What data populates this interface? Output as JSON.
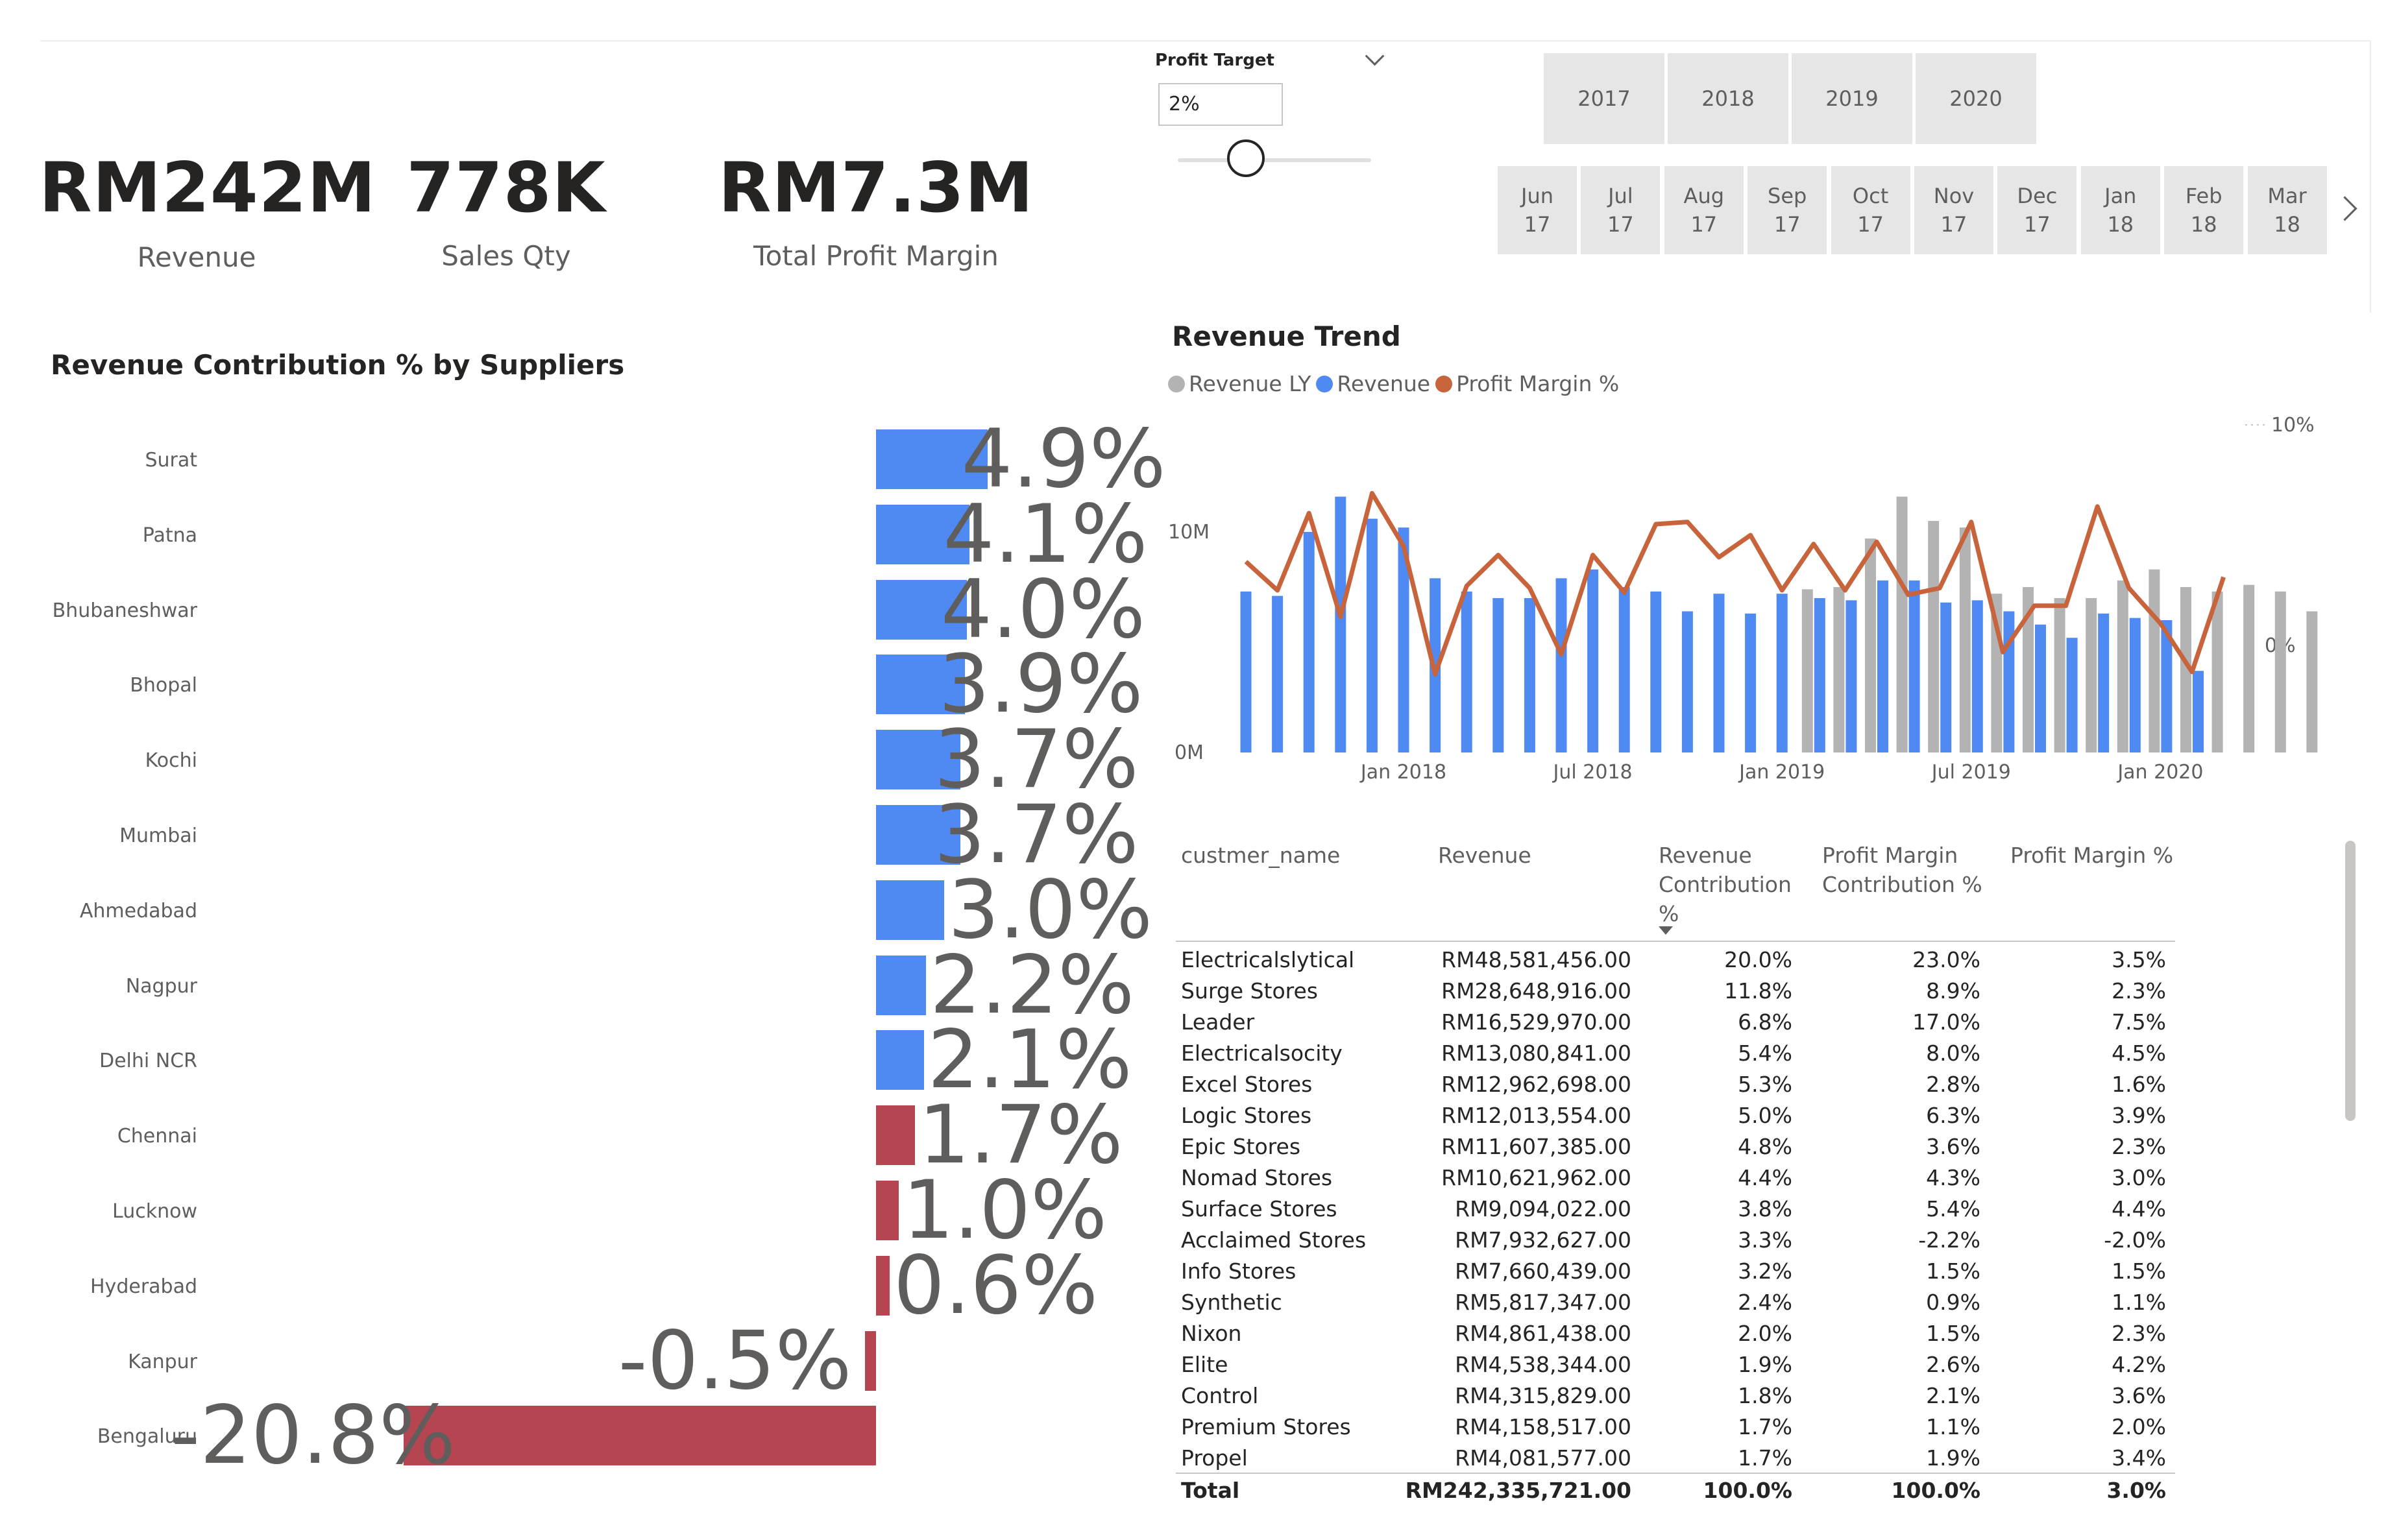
{
  "kpis": [
    {
      "value": "RM242M",
      "label": "Revenue"
    },
    {
      "value": "778K",
      "label": "Sales Qty"
    },
    {
      "value": "RM7.3M",
      "label": "Total Profit Margin"
    }
  ],
  "profit_target": {
    "title": "Profit Target",
    "value": "2%"
  },
  "years": [
    "2017",
    "2018",
    "2019",
    "2020"
  ],
  "months": [
    {
      "m": "Jun",
      "y": "17"
    },
    {
      "m": "Jul",
      "y": "17"
    },
    {
      "m": "Aug",
      "y": "17"
    },
    {
      "m": "Sep",
      "y": "17"
    },
    {
      "m": "Oct",
      "y": "17"
    },
    {
      "m": "Nov",
      "y": "17"
    },
    {
      "m": "Dec",
      "y": "17"
    },
    {
      "m": "Jan",
      "y": "18"
    },
    {
      "m": "Feb",
      "y": "18"
    },
    {
      "m": "Mar",
      "y": "18"
    }
  ],
  "suppliers_title": "Revenue Contribution % by Suppliers",
  "revenue_trend_title": "Revenue Trend",
  "legend": [
    "Revenue LY",
    "Revenue",
    "Profit Margin %"
  ],
  "colors": {
    "positive": "#4e8af2",
    "negative": "#b54550",
    "revenue_ly": "#b3b3b3",
    "revenue": "#4e8af2",
    "profit": "#c8643c"
  },
  "chart_data": [
    {
      "type": "bar",
      "title": "Revenue Contribution % by Suppliers",
      "categories": [
        "Surat",
        "Patna",
        "Bhubaneshwar",
        "Bhopal",
        "Kochi",
        "Mumbai",
        "Ahmedabad",
        "Nagpur",
        "Delhi NCR",
        "Chennai",
        "Lucknow",
        "Hyderabad",
        "Kanpur",
        "Bengaluru"
      ],
      "values": [
        4.9,
        4.1,
        4.0,
        3.9,
        3.7,
        3.7,
        3.0,
        2.2,
        2.1,
        1.7,
        1.0,
        0.6,
        -0.5,
        -20.8
      ],
      "labels": [
        "4.9%",
        "4.1%",
        "4.0%",
        "3.9%",
        "3.7%",
        "3.7%",
        "3.0%",
        "2.2%",
        "2.1%",
        "1.7%",
        "1.0%",
        "0.6%",
        "-0.5%",
        "-20.8%"
      ],
      "orientation": "horizontal"
    },
    {
      "type": "bar",
      "title": "Revenue Trend",
      "x": [
        "2017-08",
        "2017-09",
        "2017-10",
        "2017-11",
        "2017-12",
        "2018-01",
        "2018-02",
        "2018-03",
        "2018-04",
        "2018-05",
        "2018-06",
        "2018-07",
        "2018-08",
        "2018-09",
        "2018-10",
        "2018-11",
        "2018-12",
        "2019-01",
        "2019-02",
        "2019-03",
        "2019-04",
        "2019-05",
        "2019-06",
        "2019-07",
        "2019-08",
        "2019-09",
        "2019-10",
        "2019-11",
        "2019-12",
        "2020-01",
        "2020-02",
        "2020-03",
        "2020-04",
        "2020-05",
        "2020-06",
        "2020-07",
        "2020-08"
      ],
      "series": [
        {
          "name": "Revenue LY",
          "values": [
            null,
            null,
            null,
            null,
            null,
            null,
            null,
            null,
            null,
            null,
            null,
            null,
            null,
            null,
            null,
            null,
            null,
            null,
            7.4,
            7.5,
            9.7,
            11.6,
            10.5,
            10.2,
            7.2,
            7.5,
            7.0,
            7.0,
            7.8,
            8.3,
            7.5,
            7.3,
            7.6,
            7.3,
            6.4,
            7.2,
            6.6
          ],
          "axis": "left",
          "style": "bar"
        },
        {
          "name": "Revenue",
          "values": [
            7.3,
            7.1,
            10.0,
            11.6,
            10.6,
            10.2,
            7.9,
            7.3,
            7.0,
            7.0,
            7.9,
            8.3,
            7.5,
            7.3,
            6.4,
            7.2,
            6.3,
            7.2,
            7.0,
            6.9,
            7.8,
            7.8,
            6.8,
            6.9,
            6.4,
            5.8,
            5.2,
            6.3,
            6.1,
            6.0,
            3.7
          ],
          "axis": "left",
          "style": "bar"
        },
        {
          "name": "Profit Margin %",
          "values": [
            3.8,
            2.5,
            6.0,
            1.3,
            6.9,
            4.5,
            -1.3,
            2.7,
            4.1,
            2.6,
            -0.4,
            4.1,
            2.4,
            5.5,
            5.6,
            4.0,
            5.0,
            2.5,
            4.6,
            2.5,
            4.7,
            2.3,
            2.6,
            5.6,
            -0.3,
            1.8,
            1.8,
            6.3,
            2.6,
            1.0,
            -1.2,
            3.1
          ],
          "axis": "right",
          "style": "line"
        }
      ],
      "y_left_ticks": [
        "0M",
        "10M"
      ],
      "y_right_ticks": [
        "0%",
        "10%"
      ],
      "x_ticks": [
        "Jan 2018",
        "Jul 2018",
        "Jan 2019",
        "Jul 2019",
        "Jan 2020"
      ],
      "ylim_left": [
        0,
        14
      ],
      "ylim_right": [
        -3,
        10
      ]
    },
    {
      "type": "table",
      "columns": [
        "custmer_name",
        "Revenue",
        "Revenue Contribution %",
        "Profit Margin Contribution %",
        "Profit Margin %"
      ],
      "rows": [
        [
          "Electricalslytical",
          "RM48,581,456.00",
          "20.0%",
          "23.0%",
          "3.5%"
        ],
        [
          "Surge Stores",
          "RM28,648,916.00",
          "11.8%",
          "8.9%",
          "2.3%"
        ],
        [
          "Leader",
          "RM16,529,970.00",
          "6.8%",
          "17.0%",
          "7.5%"
        ],
        [
          "Electricalsocity",
          "RM13,080,841.00",
          "5.4%",
          "8.0%",
          "4.5%"
        ],
        [
          "Excel Stores",
          "RM12,962,698.00",
          "5.3%",
          "2.8%",
          "1.6%"
        ],
        [
          "Logic Stores",
          "RM12,013,554.00",
          "5.0%",
          "6.3%",
          "3.9%"
        ],
        [
          "Epic Stores",
          "RM11,607,385.00",
          "4.8%",
          "3.6%",
          "2.3%"
        ],
        [
          "Nomad Stores",
          "RM10,621,962.00",
          "4.4%",
          "4.3%",
          "3.0%"
        ],
        [
          "Surface Stores",
          "RM9,094,022.00",
          "3.8%",
          "5.4%",
          "4.4%"
        ],
        [
          "Acclaimed Stores",
          "RM7,932,627.00",
          "3.3%",
          "-2.2%",
          "-2.0%"
        ],
        [
          "Info Stores",
          "RM7,660,439.00",
          "3.2%",
          "1.5%",
          "1.5%"
        ],
        [
          "Synthetic",
          "RM5,817,347.00",
          "2.4%",
          "0.9%",
          "1.1%"
        ],
        [
          "Nixon",
          "RM4,861,438.00",
          "2.0%",
          "1.5%",
          "2.3%"
        ],
        [
          "Elite",
          "RM4,538,344.00",
          "1.9%",
          "2.6%",
          "4.2%"
        ],
        [
          "Control",
          "RM4,315,829.00",
          "1.8%",
          "2.1%",
          "3.6%"
        ],
        [
          "Premium Stores",
          "RM4,158,517.00",
          "1.7%",
          "1.1%",
          "2.0%"
        ],
        [
          "Propel",
          "RM4,081,577.00",
          "1.7%",
          "1.9%",
          "3.4%"
        ]
      ],
      "total": [
        "Total",
        "RM242,335,721.00",
        "100.0%",
        "100.0%",
        "3.0%"
      ]
    }
  ],
  "table_headers": {
    "name": "custmer_name",
    "revenue": "Revenue",
    "rev_contrib": [
      "Revenue",
      "Contribution",
      "%"
    ],
    "pm_contrib": [
      "Profit Margin",
      "Contribution %"
    ],
    "pm": "Profit Margin %"
  }
}
